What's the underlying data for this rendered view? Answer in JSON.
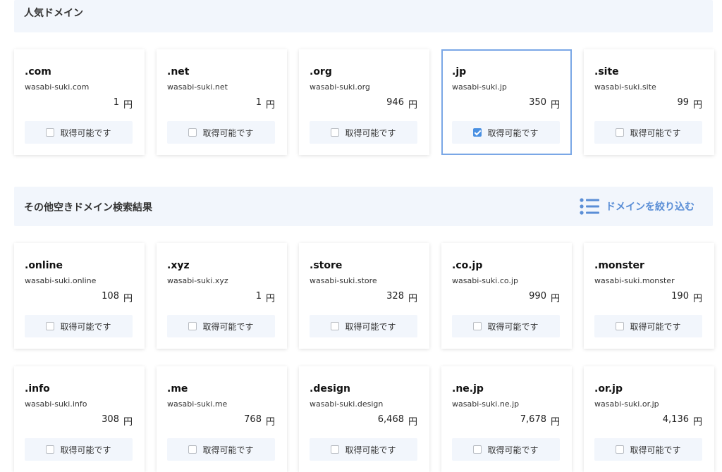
{
  "popular": {
    "title": "人気ドメイン",
    "cards": [
      {
        "tld": ".com",
        "domain": "wasabi-suki.com",
        "price": "1",
        "currency": "円",
        "status": "取得可能です",
        "checked": false
      },
      {
        "tld": ".net",
        "domain": "wasabi-suki.net",
        "price": "1",
        "currency": "円",
        "status": "取得可能です",
        "checked": false
      },
      {
        "tld": ".org",
        "domain": "wasabi-suki.org",
        "price": "946",
        "currency": "円",
        "status": "取得可能です",
        "checked": false
      },
      {
        "tld": ".jp",
        "domain": "wasabi-suki.jp",
        "price": "350",
        "currency": "円",
        "status": "取得可能です",
        "checked": true
      },
      {
        "tld": ".site",
        "domain": "wasabi-suki.site",
        "price": "99",
        "currency": "円",
        "status": "取得可能です",
        "checked": false
      }
    ]
  },
  "other": {
    "title": "その他空きドメイン検索結果",
    "filter_label": "ドメインを絞り込む",
    "cards": [
      {
        "tld": ".online",
        "domain": "wasabi-suki.online",
        "price": "108",
        "currency": "円",
        "status": "取得可能です",
        "checked": false
      },
      {
        "tld": ".xyz",
        "domain": "wasabi-suki.xyz",
        "price": "1",
        "currency": "円",
        "status": "取得可能です",
        "checked": false
      },
      {
        "tld": ".store",
        "domain": "wasabi-suki.store",
        "price": "328",
        "currency": "円",
        "status": "取得可能です",
        "checked": false
      },
      {
        "tld": ".co.jp",
        "domain": "wasabi-suki.co.jp",
        "price": "990",
        "currency": "円",
        "status": "取得可能です",
        "checked": false
      },
      {
        "tld": ".monster",
        "domain": "wasabi-suki.monster",
        "price": "190",
        "currency": "円",
        "status": "取得可能です",
        "checked": false
      },
      {
        "tld": ".info",
        "domain": "wasabi-suki.info",
        "price": "308",
        "currency": "円",
        "status": "取得可能です",
        "checked": false
      },
      {
        "tld": ".me",
        "domain": "wasabi-suki.me",
        "price": "768",
        "currency": "円",
        "status": "取得可能です",
        "checked": false
      },
      {
        "tld": ".design",
        "domain": "wasabi-suki.design",
        "price": "6,468",
        "currency": "円",
        "status": "取得可能です",
        "checked": false
      },
      {
        "tld": ".ne.jp",
        "domain": "wasabi-suki.ne.jp",
        "price": "7,678",
        "currency": "円",
        "status": "取得可能です",
        "checked": false
      },
      {
        "tld": ".or.jp",
        "domain": "wasabi-suki.or.jp",
        "price": "4,136",
        "currency": "円",
        "status": "取得可能です",
        "checked": false
      }
    ]
  },
  "colors": {
    "accent": "#4a90e2",
    "header_bg": "#f2f6fc",
    "selected_border": "#7aa7e6"
  },
  "icons": {
    "filter": "list-filter-icon",
    "checkbox": "checkbox-icon"
  }
}
